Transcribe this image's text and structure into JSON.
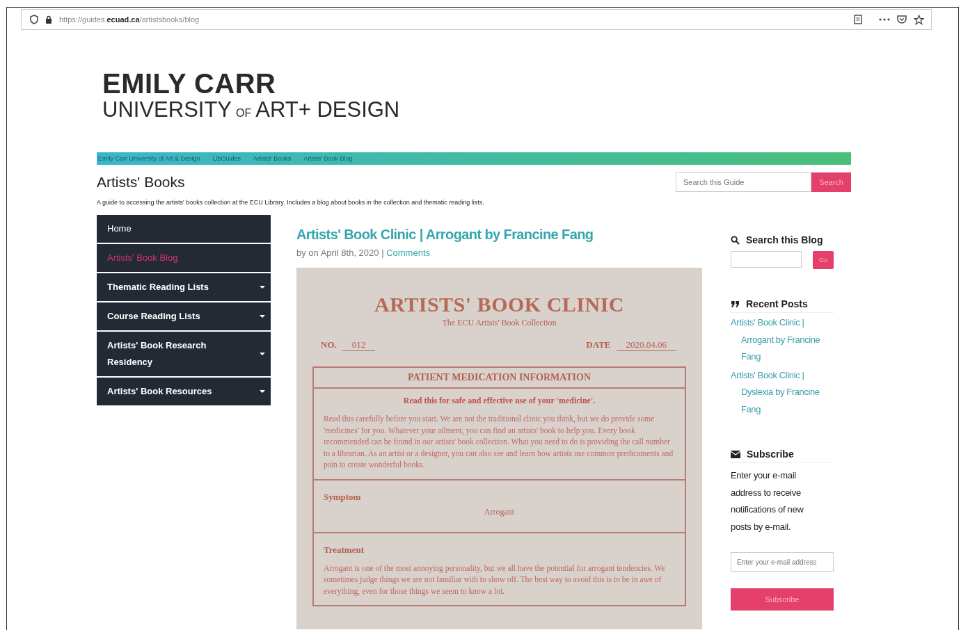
{
  "browser": {
    "url": "https://guides.**ecuad.ca**/artistsbooks/blog"
  },
  "logo": {
    "line1": "EMILY CARR",
    "line2": "UNIVERSITY",
    "small": "OF",
    "line3": "ART+ DESIGN"
  },
  "breadcrumbs": [
    "Emily Carr University of Art & Design",
    "LibGuides",
    "Artists' Books",
    "Artists' Book Blog"
  ],
  "guide": {
    "title": "Artists' Books",
    "description": "A guide to accessing the artists' books collection at the ECU Library. Includes a blog about books in the collection and thematic reading lists.",
    "search": {
      "placeholder": "Search this Guide",
      "button": "Search"
    }
  },
  "nav": [
    {
      "label": "Home",
      "selected": false,
      "expandable": false
    },
    {
      "label": "Artists' Book Blog",
      "selected": true,
      "expandable": false
    },
    {
      "label": "Thematic Reading Lists",
      "selected": false,
      "expandable": true
    },
    {
      "label": "Course Reading Lists",
      "selected": false,
      "expandable": true
    },
    {
      "label": "Artists' Book Research Residency",
      "selected": false,
      "expandable": true
    },
    {
      "label": "Artists' Book Resources",
      "selected": false,
      "expandable": true
    }
  ],
  "post": {
    "title": "Artists' Book Clinic | Arrogant by Francine Fang",
    "meta": "by on April 8th, 2020 |",
    "comments": "Comments",
    "document": {
      "title": "ARTISTS' BOOK CLINIC",
      "subtitle": "The ECU Artists' Book Collection",
      "no_label": "NO.",
      "no": "012",
      "date_label": "DATE",
      "date": "2020.04.06",
      "header": "PATIENT MEDICATION INFORMATION",
      "lead": "Read this for safe and effective use of your 'medicine'.",
      "intro": "Read this carefully before you start. We are not the traditional clinic you think, but we do provide some 'medicines' for you. Whatever your ailment, you can find an artists' book to help you. Every book recommended can be found in our artists' book collection. What you need to do is providing the call number to a librarian. As an artist or a designer, you can also see and learn how artists use common predicaments and pain to create wonderful books.",
      "symptom_label": "Symptom",
      "symptom": "Arrogant",
      "treatment_label": "Treatment",
      "treatment": "Arrogant is one of the most annoying personality, but we all have the potential for arrogant tendencies. We sometimes judge things we are not familiar with to show off. The best way to avoid this is to be in awe of everything, even for those things we seem to know a lot."
    }
  },
  "sidebar": {
    "search": {
      "heading": "Search this Blog",
      "button": "Go"
    },
    "recent": {
      "heading": "Recent Posts",
      "posts": [
        "Artists' Book Clinic | Arrogant by Francine Fang",
        "Artists' Book Clinic | Dyslexia by Francine Fang"
      ]
    },
    "subscribe": {
      "heading": "Subscribe",
      "text": "Enter your e-mail address to receive notifications of new posts by e-mail.",
      "placeholder": "Enter your e-mail address",
      "button": "Subscribe"
    }
  }
}
